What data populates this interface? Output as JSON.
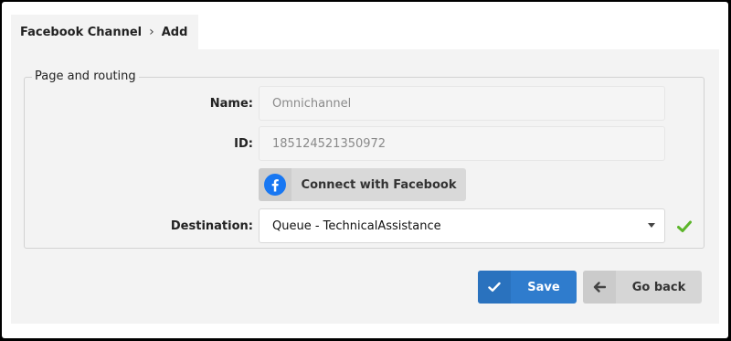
{
  "breadcrumb": {
    "section": "Facebook Channel",
    "separator": "›",
    "current": "Add"
  },
  "form": {
    "legend": "Page and routing",
    "name": {
      "label": "Name:",
      "placeholder": "Omnichannel"
    },
    "id": {
      "label": "ID:",
      "placeholder": "185124521350972"
    },
    "connect_button": {
      "label": "Connect with Facebook",
      "icon": "facebook-icon"
    },
    "destination": {
      "label": "Destination:",
      "value": "Queue - TechnicalAssistance",
      "status_icon": "checkmark-icon"
    }
  },
  "actions": {
    "save": {
      "label": "Save",
      "icon": "checkmark-icon"
    },
    "back": {
      "label": "Go back",
      "icon": "arrow-left-icon"
    }
  },
  "colors": {
    "primary": "#2f7ccd",
    "facebook": "#1877f2",
    "success": "#5cb52a"
  }
}
